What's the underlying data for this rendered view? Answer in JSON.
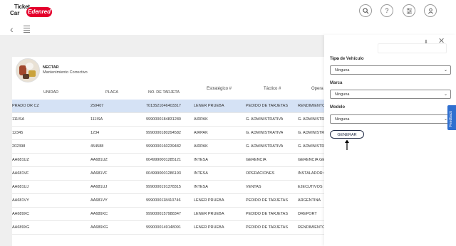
{
  "brand": {
    "line1": "Ticket",
    "line2": "Car",
    "badge": "Edenred"
  },
  "header_icons": [
    "search-icon",
    "help-icon",
    "settings-icon",
    "user-icon"
  ],
  "company": {
    "name": "NECTAR",
    "subtitle": "Mantenimiento Correctivo"
  },
  "table": {
    "headers": {
      "unidad": "UNIDAD",
      "placa": "PLACA",
      "tarjeta": "NO. DE TARJETA",
      "estrategico": "Estratégico #",
      "tactico": "Táctico #",
      "operativo": "Opera"
    },
    "rows": [
      {
        "unidad": "PRADO DR CZ",
        "placa": "259407",
        "tarjeta": "7013521046403317",
        "estrategico": "LENER PRUEBA",
        "tactico": "PEDIDO DE TARJETAS",
        "operativo": "RENDIMIENTO"
      },
      {
        "unidad": "111ISA",
        "placa": "111ISA",
        "tarjeta": "9990000184831280",
        "estrategico": "AIRPAK",
        "tactico": "G. ADMINISTRATIVA",
        "operativo": "G. ADMINISTR"
      },
      {
        "unidad": "12345",
        "placa": "1234",
        "tarjeta": "9990000180294582",
        "estrategico": "AIRPAK",
        "tactico": "G. ADMINISTRATIVA",
        "operativo": "G. ADMINISTR"
      },
      {
        "unidad": "202398",
        "placa": "454588",
        "tarjeta": "9990000160239482",
        "estrategico": "AIRPAK",
        "tactico": "G. ADMINISTRATIVA",
        "operativo": "G. ADMINISTR"
      },
      {
        "unidad": "AA681UZ",
        "placa": "AA681UZ",
        "tarjeta": "0049990001285121",
        "estrategico": "INTESA",
        "tactico": "GERENCIA",
        "operativo": "GERENCIA GEN"
      },
      {
        "unidad": "AA681VF",
        "placa": "AA681VF",
        "tarjeta": "0049990001286193",
        "estrategico": "INTESA",
        "tactico": "OPERACIONES",
        "operativo": "INSTALADOR G"
      },
      {
        "unidad": "AA681UJ",
        "placa": "AA681UJ",
        "tarjeta": "9990000191378315",
        "estrategico": "INTESA",
        "tactico": "VENTAS",
        "operativo": "EJECUTIVOS"
      },
      {
        "unidad": "AA681VY",
        "placa": "AA681VY",
        "tarjeta": "9990000118410746",
        "estrategico": "LENER PRUEBA",
        "tactico": "PEDIDO DE TARJETAS",
        "operativo": "ARGENTINA"
      },
      {
        "unidad": "AA689XC",
        "placa": "AA689XC",
        "tarjeta": "9990000157988347",
        "estrategico": "LENER PRUEBA",
        "tactico": "PEDIDO DE TARJETAS",
        "operativo": "DREPORT"
      },
      {
        "unidad": "AA689XG",
        "placa": "AA689XG",
        "tarjeta": "9990000149148091",
        "estrategico": "LENER PRUEBA",
        "tactico": "PEDIDO DE TARJETAS",
        "operativo": "RENDIMIENTO"
      }
    ]
  },
  "panel": {
    "tipo_label": "Tipo de Vehículo",
    "tipo_value": "Ninguna",
    "marca_label": "Marca",
    "marca_value": "Ninguna",
    "modelo_label": "Modelo",
    "modelo_value": "Ninguna",
    "generar_label": "GENERAR"
  },
  "feedback_label": "Feedback",
  "colors": {
    "brand_red": "#e4002b",
    "selected_row": "#d5e2f5",
    "feedback": "#2f6fcf",
    "button_border": "#1f2a44"
  }
}
